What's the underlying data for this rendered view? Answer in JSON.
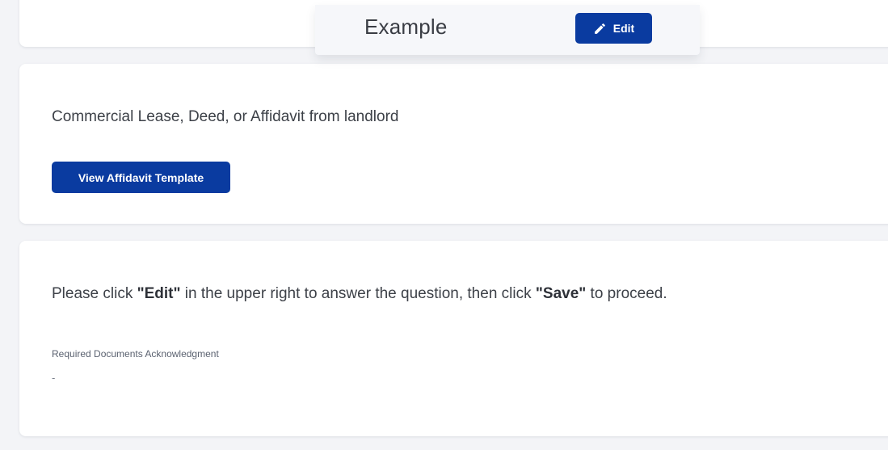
{
  "header": {
    "title": "Example",
    "edit_label": "Edit",
    "edit_icon": "pencil-icon"
  },
  "document_card": {
    "text": "Commercial Lease, Deed, or Affidavit from landlord",
    "button_label": "View Affidavit Template"
  },
  "acknowledgment_card": {
    "instruction_prefix": "Please click ",
    "instruction_edit": "\"Edit\"",
    "instruction_middle": " in the upper right to answer the question, then click ",
    "instruction_save": "\"Save\"",
    "instruction_suffix": " to proceed.",
    "field_label": "Required Documents Acknowledgment",
    "field_value": "-"
  },
  "colors": {
    "primary": "#0a3ba0",
    "background": "#f3f4f7",
    "card": "#ffffff",
    "text": "#3d4148"
  }
}
